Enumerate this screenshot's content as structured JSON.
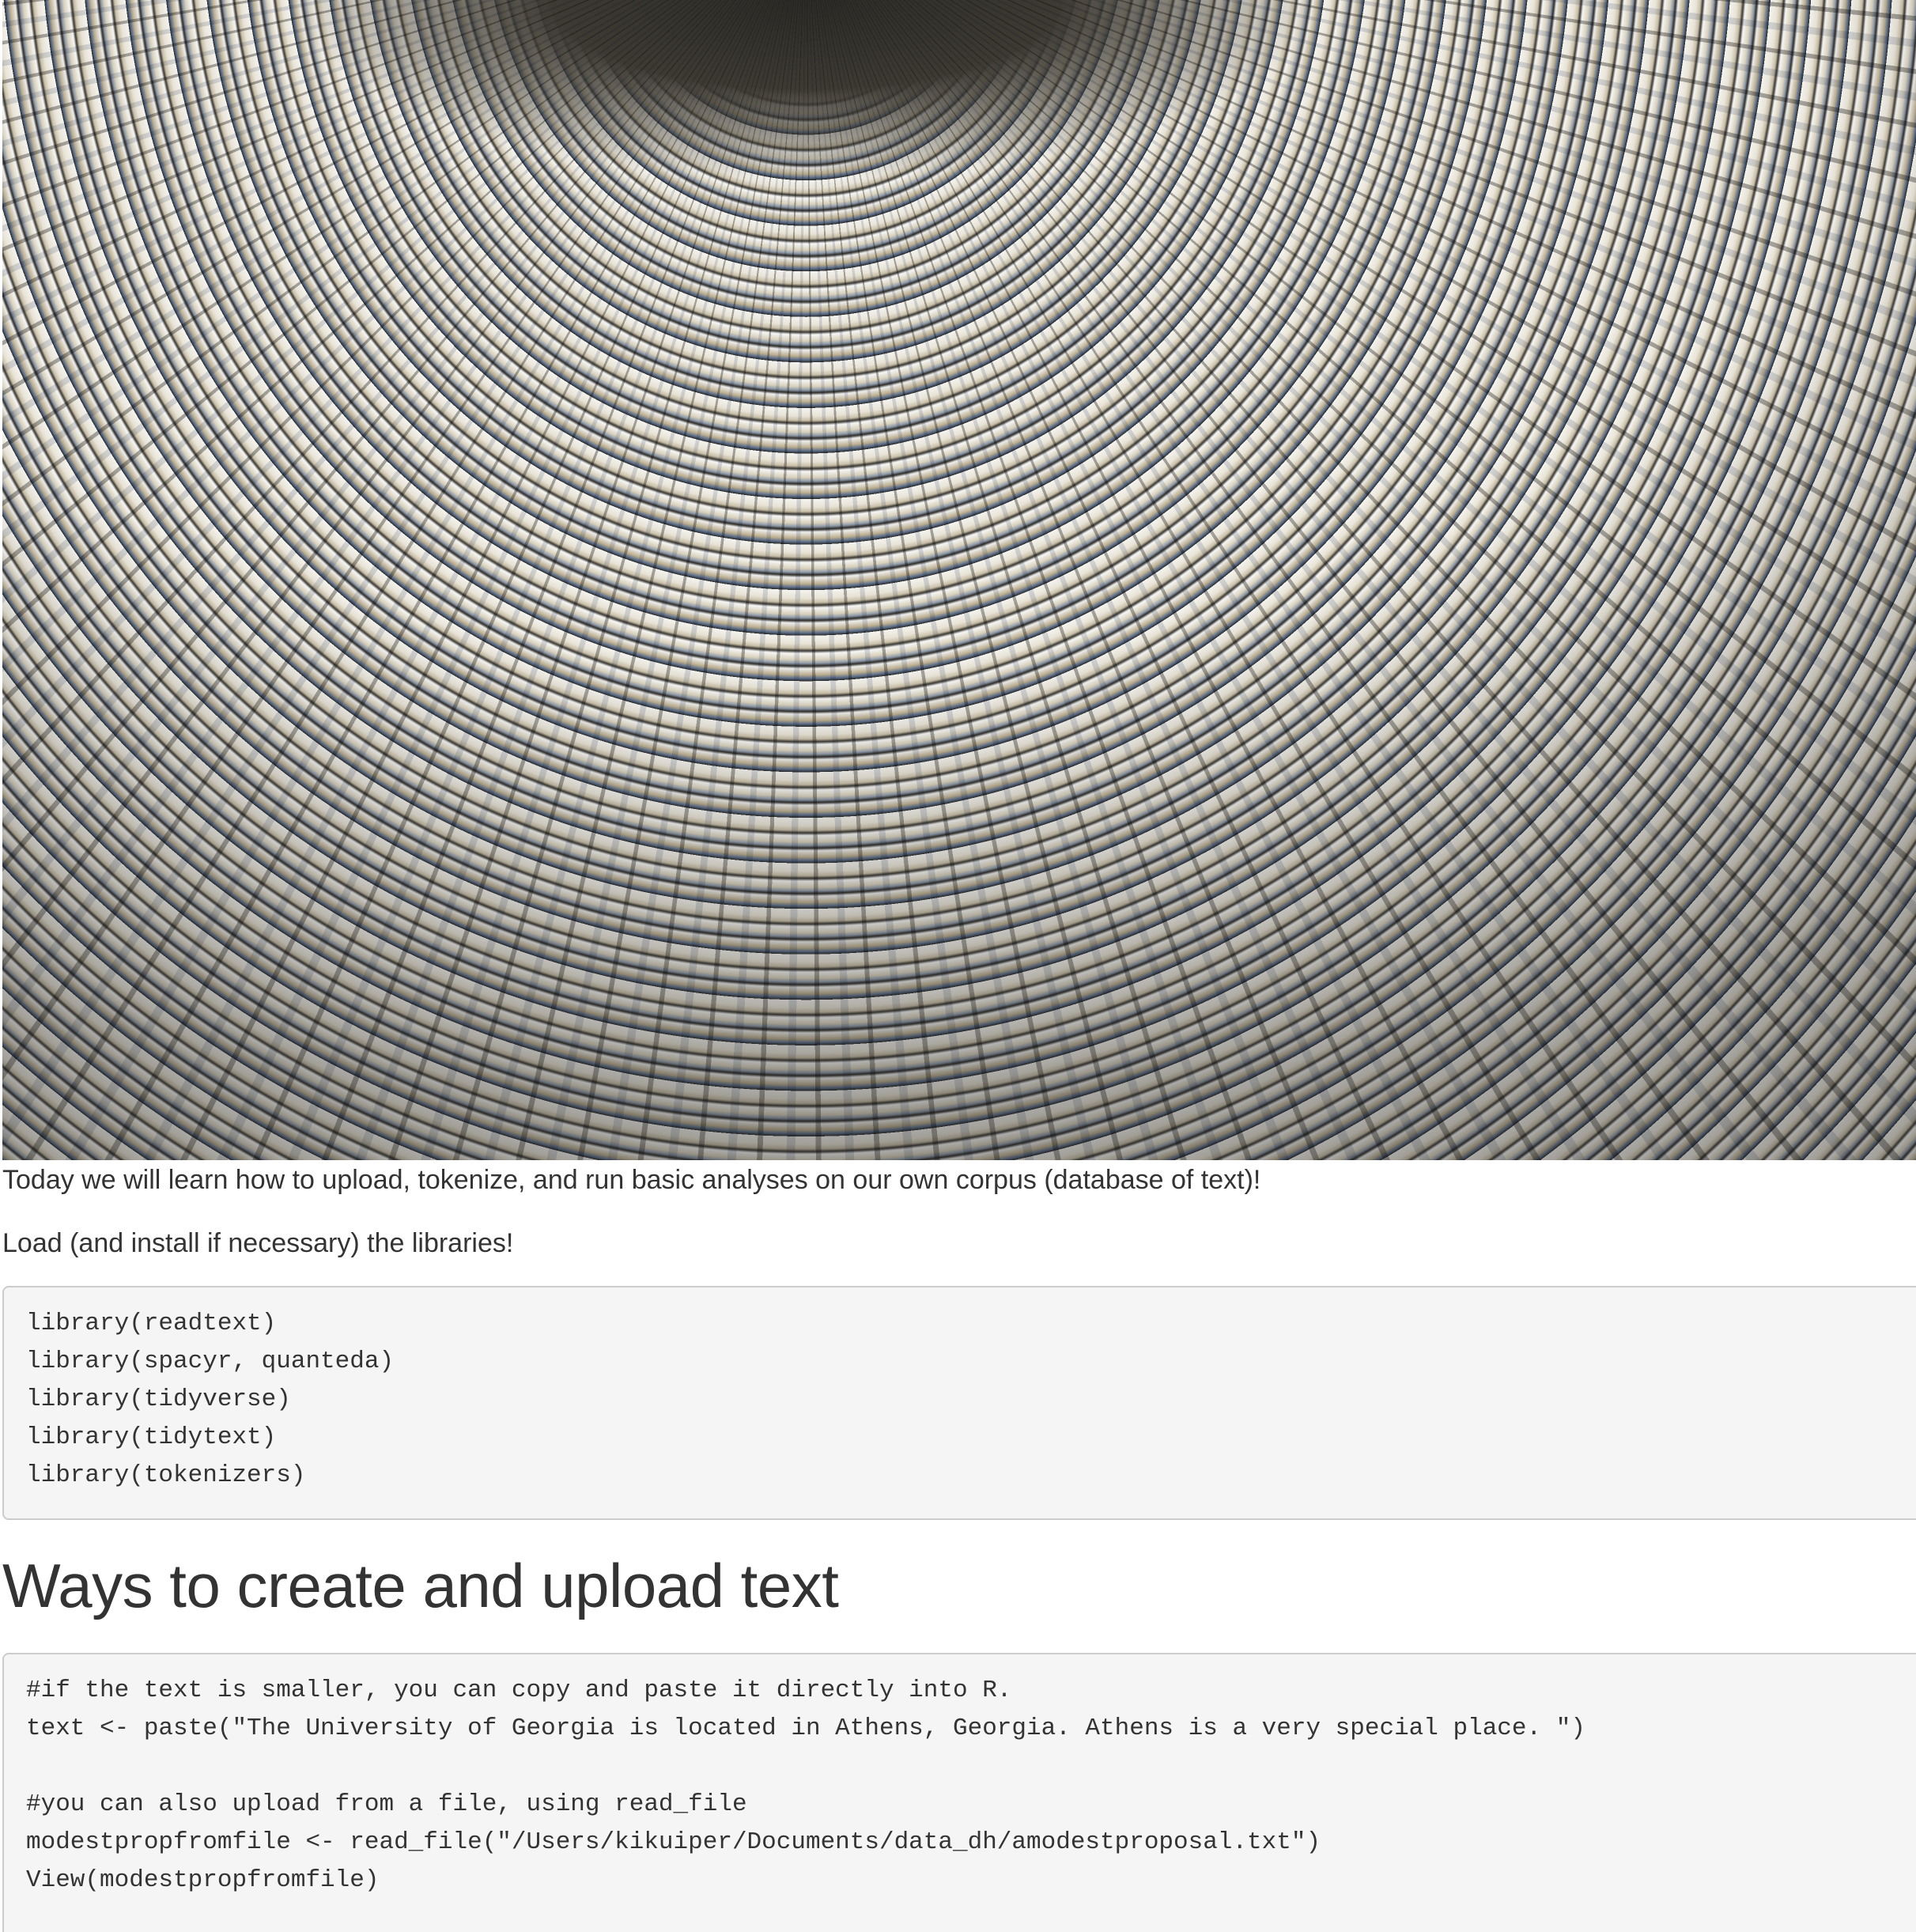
{
  "intro": {
    "line1": "Today we will learn how to upload, tokenize, and run basic analyses on our own corpus (database of text)!",
    "line2": "Load (and install if necessary) the libraries!"
  },
  "code_libraries": [
    "library(readtext)",
    "library(spacyr, quanteda)",
    "library(tidyverse)",
    "library(tidytext)",
    "library(tokenizers)"
  ],
  "section": {
    "title": "Ways to create and upload text"
  },
  "code_upload": [
    "#if the text is smaller, you can copy and paste it directly into R.",
    "text <- paste(\"The University of Georgia is located in Athens, Georgia. Athens is a very special place. \")",
    "",
    "#you can also upload from a file, using read_file",
    "modestpropfromfile <- read_file(\"/Users/kikuiper/Documents/data_dh/amodestproposal.txt\")",
    "View(modestpropfromfile)"
  ]
}
